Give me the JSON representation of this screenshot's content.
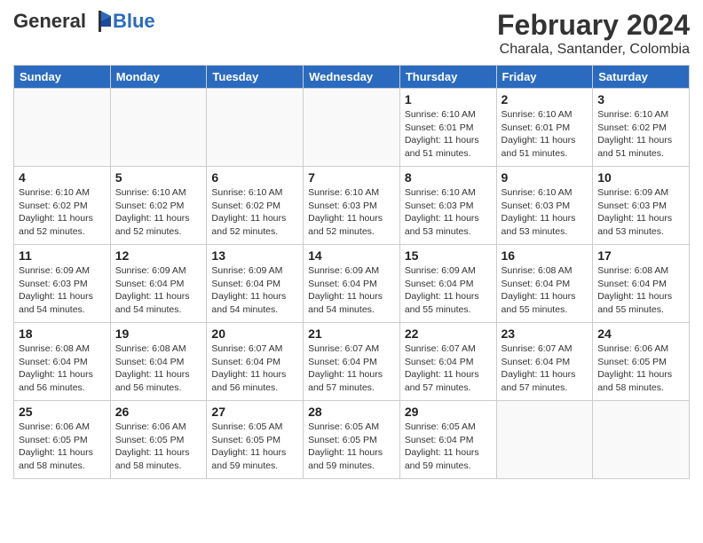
{
  "header": {
    "logo_general": "General",
    "logo_blue": "Blue",
    "month_year": "February 2024",
    "location": "Charala, Santander, Colombia"
  },
  "days_of_week": [
    "Sunday",
    "Monday",
    "Tuesday",
    "Wednesday",
    "Thursday",
    "Friday",
    "Saturday"
  ],
  "weeks": [
    [
      {
        "day": "",
        "info": ""
      },
      {
        "day": "",
        "info": ""
      },
      {
        "day": "",
        "info": ""
      },
      {
        "day": "",
        "info": ""
      },
      {
        "day": "1",
        "info": "Sunrise: 6:10 AM\nSunset: 6:01 PM\nDaylight: 11 hours\nand 51 minutes."
      },
      {
        "day": "2",
        "info": "Sunrise: 6:10 AM\nSunset: 6:01 PM\nDaylight: 11 hours\nand 51 minutes."
      },
      {
        "day": "3",
        "info": "Sunrise: 6:10 AM\nSunset: 6:02 PM\nDaylight: 11 hours\nand 51 minutes."
      }
    ],
    [
      {
        "day": "4",
        "info": "Sunrise: 6:10 AM\nSunset: 6:02 PM\nDaylight: 11 hours\nand 52 minutes."
      },
      {
        "day": "5",
        "info": "Sunrise: 6:10 AM\nSunset: 6:02 PM\nDaylight: 11 hours\nand 52 minutes."
      },
      {
        "day": "6",
        "info": "Sunrise: 6:10 AM\nSunset: 6:02 PM\nDaylight: 11 hours\nand 52 minutes."
      },
      {
        "day": "7",
        "info": "Sunrise: 6:10 AM\nSunset: 6:03 PM\nDaylight: 11 hours\nand 52 minutes."
      },
      {
        "day": "8",
        "info": "Sunrise: 6:10 AM\nSunset: 6:03 PM\nDaylight: 11 hours\nand 53 minutes."
      },
      {
        "day": "9",
        "info": "Sunrise: 6:10 AM\nSunset: 6:03 PM\nDaylight: 11 hours\nand 53 minutes."
      },
      {
        "day": "10",
        "info": "Sunrise: 6:09 AM\nSunset: 6:03 PM\nDaylight: 11 hours\nand 53 minutes."
      }
    ],
    [
      {
        "day": "11",
        "info": "Sunrise: 6:09 AM\nSunset: 6:03 PM\nDaylight: 11 hours\nand 54 minutes."
      },
      {
        "day": "12",
        "info": "Sunrise: 6:09 AM\nSunset: 6:04 PM\nDaylight: 11 hours\nand 54 minutes."
      },
      {
        "day": "13",
        "info": "Sunrise: 6:09 AM\nSunset: 6:04 PM\nDaylight: 11 hours\nand 54 minutes."
      },
      {
        "day": "14",
        "info": "Sunrise: 6:09 AM\nSunset: 6:04 PM\nDaylight: 11 hours\nand 54 minutes."
      },
      {
        "day": "15",
        "info": "Sunrise: 6:09 AM\nSunset: 6:04 PM\nDaylight: 11 hours\nand 55 minutes."
      },
      {
        "day": "16",
        "info": "Sunrise: 6:08 AM\nSunset: 6:04 PM\nDaylight: 11 hours\nand 55 minutes."
      },
      {
        "day": "17",
        "info": "Sunrise: 6:08 AM\nSunset: 6:04 PM\nDaylight: 11 hours\nand 55 minutes."
      }
    ],
    [
      {
        "day": "18",
        "info": "Sunrise: 6:08 AM\nSunset: 6:04 PM\nDaylight: 11 hours\nand 56 minutes."
      },
      {
        "day": "19",
        "info": "Sunrise: 6:08 AM\nSunset: 6:04 PM\nDaylight: 11 hours\nand 56 minutes."
      },
      {
        "day": "20",
        "info": "Sunrise: 6:07 AM\nSunset: 6:04 PM\nDaylight: 11 hours\nand 56 minutes."
      },
      {
        "day": "21",
        "info": "Sunrise: 6:07 AM\nSunset: 6:04 PM\nDaylight: 11 hours\nand 57 minutes."
      },
      {
        "day": "22",
        "info": "Sunrise: 6:07 AM\nSunset: 6:04 PM\nDaylight: 11 hours\nand 57 minutes."
      },
      {
        "day": "23",
        "info": "Sunrise: 6:07 AM\nSunset: 6:04 PM\nDaylight: 11 hours\nand 57 minutes."
      },
      {
        "day": "24",
        "info": "Sunrise: 6:06 AM\nSunset: 6:05 PM\nDaylight: 11 hours\nand 58 minutes."
      }
    ],
    [
      {
        "day": "25",
        "info": "Sunrise: 6:06 AM\nSunset: 6:05 PM\nDaylight: 11 hours\nand 58 minutes."
      },
      {
        "day": "26",
        "info": "Sunrise: 6:06 AM\nSunset: 6:05 PM\nDaylight: 11 hours\nand 58 minutes."
      },
      {
        "day": "27",
        "info": "Sunrise: 6:05 AM\nSunset: 6:05 PM\nDaylight: 11 hours\nand 59 minutes."
      },
      {
        "day": "28",
        "info": "Sunrise: 6:05 AM\nSunset: 6:05 PM\nDaylight: 11 hours\nand 59 minutes."
      },
      {
        "day": "29",
        "info": "Sunrise: 6:05 AM\nSunset: 6:04 PM\nDaylight: 11 hours\nand 59 minutes."
      },
      {
        "day": "",
        "info": ""
      },
      {
        "day": "",
        "info": ""
      }
    ]
  ]
}
